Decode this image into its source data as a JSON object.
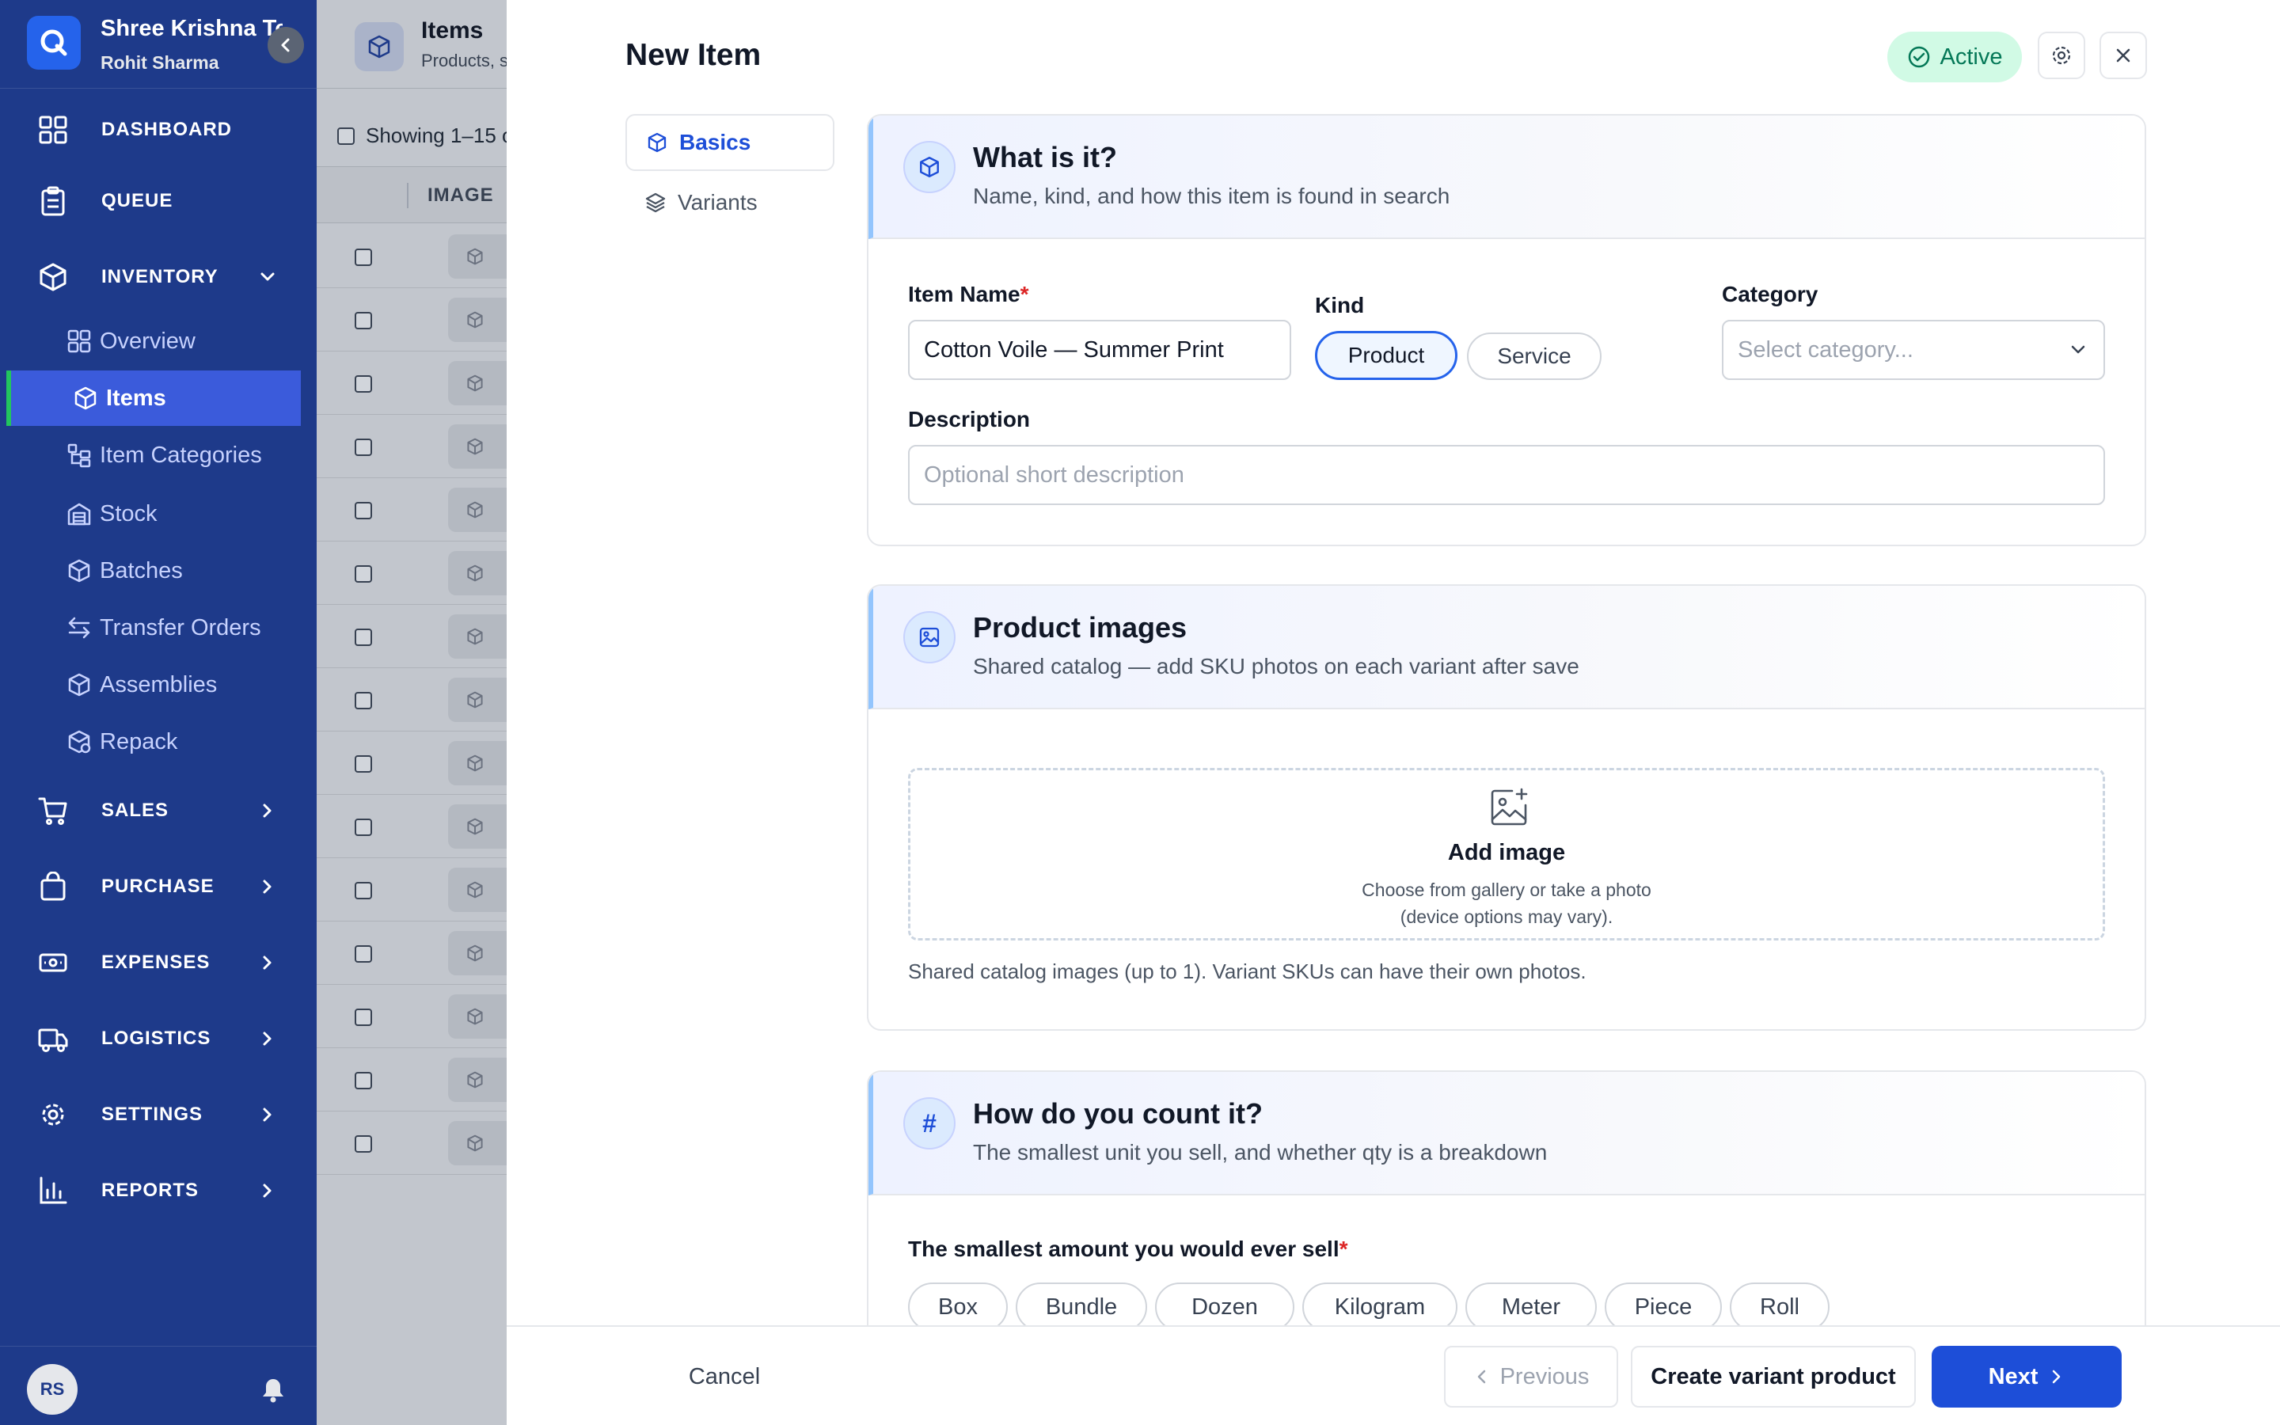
{
  "sidebar": {
    "org_name": "Shree Krishna Te",
    "user_name": "Rohit Sharma",
    "nav": {
      "dashboard": "DASHBOARD",
      "queue": "QUEUE",
      "inventory": "INVENTORY",
      "sales": "SALES",
      "purchase": "PURCHASE",
      "expenses": "EXPENSES",
      "logistics": "LOGISTICS",
      "settings": "SETTINGS",
      "reports": "REPORTS"
    },
    "inventory_items": {
      "overview": "Overview",
      "items": "Items",
      "item_categories": "Item Categories",
      "stock": "Stock",
      "batches": "Batches",
      "transfer_orders": "Transfer Orders",
      "assemblies": "Assemblies",
      "repack": "Repack"
    },
    "user_initials": "RS"
  },
  "background": {
    "title": "Items",
    "subtitle": "Products, s",
    "showing": "Showing 1–15 o",
    "column_image": "IMAGE"
  },
  "modal": {
    "title": "New Item",
    "status_badge": "Active",
    "steps": {
      "basics": "Basics",
      "variants": "Variants"
    },
    "section_what": {
      "title": "What is it?",
      "subtitle": "Name, kind, and how this item is found in search",
      "item_name_label": "Item Name",
      "required_mark": "*",
      "item_name_value": "Cotton Voile — Summer Print",
      "kind_label": "Kind",
      "kind_product": "Product",
      "kind_service": "Service",
      "category_label": "Category",
      "category_placeholder": "Select category...",
      "description_label": "Description",
      "description_placeholder": "Optional short description"
    },
    "section_images": {
      "title": "Product images",
      "subtitle": "Shared catalog — add SKU photos on each variant after save",
      "add_image": "Add image",
      "add_image_hint_1": "Choose from gallery or take a photo",
      "add_image_hint_2": "(device options may vary).",
      "note": "Shared catalog images (up to 1). Variant SKUs can have their own photos."
    },
    "section_count": {
      "icon_glyph": "#",
      "title": "How do you count it?",
      "subtitle": "The smallest unit you sell, and whether qty is a breakdown",
      "smallest_label": "The smallest amount you would ever sell",
      "units": [
        "Box",
        "Bundle",
        "Dozen",
        "Kilogram",
        "Meter",
        "Piece",
        "Roll"
      ]
    },
    "footer": {
      "cancel": "Cancel",
      "previous": "Previous",
      "create_variant": "Create variant product",
      "next": "Next"
    }
  },
  "colors": {
    "sidebar_bg": "#1e3a8a",
    "active_nav": "#3b5bdb",
    "accent": "#1d4ed8",
    "success_bg": "#d1fae5",
    "success_text": "#047857",
    "required": "#dc2626"
  }
}
